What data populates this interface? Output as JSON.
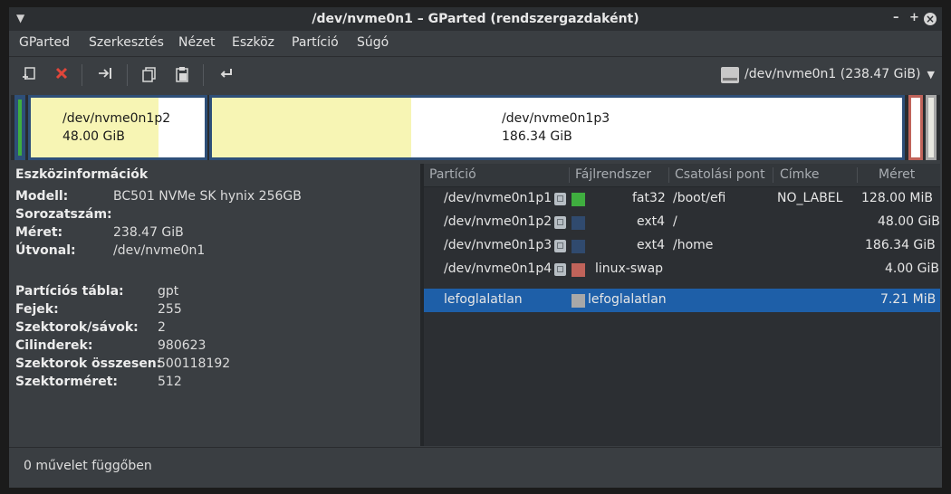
{
  "window": {
    "title": "/dev/nvme0n1 – GParted (rendszergazdaként)",
    "controls": {
      "minimize": "–",
      "maximize": "+",
      "close": "×"
    }
  },
  "menu": [
    "GParted",
    "Szerkesztés",
    "Nézet",
    "Eszköz",
    "Partíció",
    "Súgó"
  ],
  "toolbar": {
    "icons": [
      "new-partition-icon",
      "delete-icon",
      "resize-move-icon",
      "copy-icon",
      "paste-icon",
      "undo-icon"
    ],
    "device_selector": "/dev/nvme0n1 (238.47 GiB)"
  },
  "partition_map": [
    {
      "name": "/dev/nvme0n1p2",
      "size": "48.00 GiB",
      "used_fraction": 0.74
    },
    {
      "name": "/dev/nvme0n1p3",
      "size": "186.34 GiB",
      "used_fraction": 0.29
    }
  ],
  "device_info": {
    "header": "Eszközinformációk",
    "general": [
      {
        "key": "Modell:",
        "value": "BC501 NVMe SK hynix 256GB"
      },
      {
        "key": "Sorozatszám:",
        "value": ""
      },
      {
        "key": "Méret:",
        "value": "238.47 GiB"
      },
      {
        "key": "Útvonal:",
        "value": "/dev/nvme0n1"
      }
    ],
    "details": [
      {
        "key": "Partíciós tábla:",
        "value": "gpt"
      },
      {
        "key": "Fejek:",
        "value": "255"
      },
      {
        "key": "Szektorok/sávok:",
        "value": "2"
      },
      {
        "key": "Cilinderek:",
        "value": "980623"
      },
      {
        "key": "Szektorok összesen:",
        "value": "500118192"
      },
      {
        "key": "Szektorméret:",
        "value": "512"
      }
    ]
  },
  "table": {
    "headers": [
      "Partíció",
      "Fájlrendszer",
      "Csatolási pont",
      "Címke",
      "Méret"
    ],
    "rows": [
      {
        "partition": "/dev/nvme0n1p1",
        "fs": "fat32",
        "fs_color": "#3fae3f",
        "mount": "/boot/efi",
        "label": "NO_LABEL",
        "size": "128.00 MiB",
        "locked": true,
        "selected": false
      },
      {
        "partition": "/dev/nvme0n1p2",
        "fs": "ext4",
        "fs_color": "#304a6e",
        "mount": "/",
        "label": "",
        "size": "48.00 GiB",
        "locked": true,
        "selected": false
      },
      {
        "partition": "/dev/nvme0n1p3",
        "fs": "ext4",
        "fs_color": "#304a6e",
        "mount": "/home",
        "label": "",
        "size": "186.34 GiB",
        "locked": true,
        "selected": false
      },
      {
        "partition": "/dev/nvme0n1p4",
        "fs": "linux-swap",
        "fs_color": "#c0635a",
        "mount": "",
        "label": "",
        "size": "4.00 GiB",
        "locked": true,
        "selected": false
      },
      {
        "partition": "lefoglalatlan",
        "fs": "lefoglalatlan",
        "fs_color": "#a8a8a8",
        "mount": "",
        "label": "",
        "size": "7.21 MiB",
        "locked": false,
        "selected": true
      }
    ]
  },
  "status": {
    "pending": "0 művelet függőben"
  }
}
